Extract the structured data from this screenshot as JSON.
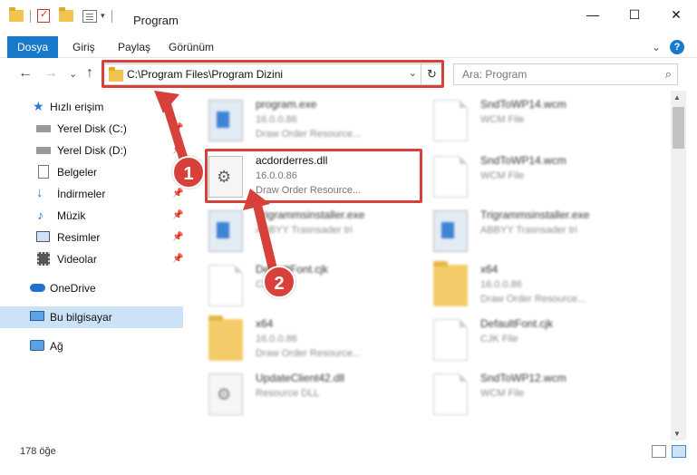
{
  "window": {
    "title": "Program",
    "controls": {
      "minimize": "—",
      "maximize": "☐",
      "close": "✕"
    }
  },
  "ribbon": {
    "tabs": [
      {
        "label": "Dosya",
        "active": true
      },
      {
        "label": "Giriş"
      },
      {
        "label": "Paylaş"
      },
      {
        "label": "Görünüm"
      }
    ],
    "expand_glyph": "⌄",
    "help_glyph": "?"
  },
  "nav": {
    "back": "←",
    "forward": "→",
    "recent": "⌄",
    "up": "↑",
    "address": "C:\\Program Files\\Program Dizini",
    "address_dropdown": "⌄",
    "refresh": "↻",
    "search_placeholder": "Ara: Program",
    "search_icon": "search-icon"
  },
  "sidebar": {
    "items": [
      {
        "label": "Hızlı erişim",
        "icon": "star-icon",
        "pinned": false
      },
      {
        "label": "Yerel Disk (C:)",
        "icon": "drive-icon",
        "pinned": true
      },
      {
        "label": "Yerel Disk (D:)",
        "icon": "drive-icon",
        "pinned": true
      },
      {
        "label": "Belgeler",
        "icon": "documents-icon",
        "pinned": true
      },
      {
        "label": "İndirmeler",
        "icon": "download-icon",
        "pinned": true
      },
      {
        "label": "Müzik",
        "icon": "music-icon",
        "pinned": true
      },
      {
        "label": "Resimler",
        "icon": "pictures-icon",
        "pinned": true
      },
      {
        "label": "Videolar",
        "icon": "videos-icon",
        "pinned": true
      },
      {
        "label": "OneDrive",
        "icon": "cloud-icon",
        "pinned": false
      },
      {
        "label": "Bu bilgisayar",
        "icon": "computer-icon",
        "pinned": false,
        "selected": true
      },
      {
        "label": "Ağ",
        "icon": "network-icon",
        "pinned": false
      }
    ]
  },
  "files": [
    {
      "name": "program.exe",
      "line2": "16.0.0.86",
      "line3": "Draw Order Resource...",
      "icon": "exe-icon"
    },
    {
      "name": "SndToWP14.wcm",
      "line2": "WCM File",
      "line3": "",
      "icon": "document-icon"
    },
    {
      "name": "acdorderres.dll",
      "line2": "16.0.0.86",
      "line3": "Draw Order Resource...",
      "icon": "dll-gear-icon"
    },
    {
      "name": "SndToWP14.wcm",
      "line2": "WCM File",
      "line3": "",
      "icon": "document-icon"
    },
    {
      "name": "Trigrammsinstaller.exe",
      "line2": "ABBYY Trasnsader tri",
      "line3": "",
      "icon": "app-icon"
    },
    {
      "name": "Trigrammsinstaller.exe",
      "line2": "ABBYY Trasnsader tri",
      "line3": "",
      "icon": "app-icon"
    },
    {
      "name": "DefaultFont.cjk",
      "line2": "CJK File",
      "line3": "",
      "icon": "document-icon"
    },
    {
      "name": "x64",
      "line2": "16.0.0.86",
      "line3": "Draw Order Resource...",
      "icon": "folder-icon"
    },
    {
      "name": "x64",
      "line2": "16.0.0.86",
      "line3": "Draw Order Resource...",
      "icon": "folder-icon"
    },
    {
      "name": "DefaultFont.cjk",
      "line2": "CJK File",
      "line3": "",
      "icon": "document-icon"
    },
    {
      "name": "UpdateClient42.dll",
      "line2": "Resource DLL",
      "line3": "",
      "icon": "dll-gear-icon"
    },
    {
      "name": "SndToWP12.wcm",
      "line2": "WCM File",
      "line3": "",
      "icon": "document-icon"
    }
  ],
  "status": {
    "count": "178 öğe"
  },
  "annotations": {
    "callout1": "1",
    "callout2": "2"
  }
}
